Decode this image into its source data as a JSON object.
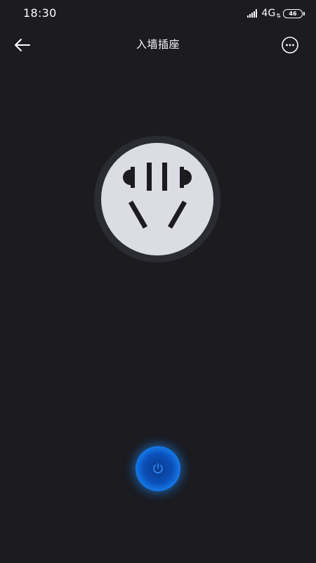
{
  "status_bar": {
    "time": "18:30",
    "network": "4G",
    "network_arrows": "⇅",
    "battery": "46",
    "icons": [
      "signal-icon",
      "battery-icon"
    ]
  },
  "header": {
    "title": "入墙插座",
    "back_icon": "back-arrow-icon",
    "more_icon": "more-options-icon"
  },
  "socket": {
    "icon": "wall-socket-icon",
    "state": "off"
  },
  "power": {
    "icon": "power-icon",
    "accent_color": "#1a8cff"
  },
  "colors": {
    "background": "#1b1b20",
    "socket_face": "#dcdde4",
    "socket_ring": "#2b2c33",
    "socket_holes": "#1b1b20"
  }
}
